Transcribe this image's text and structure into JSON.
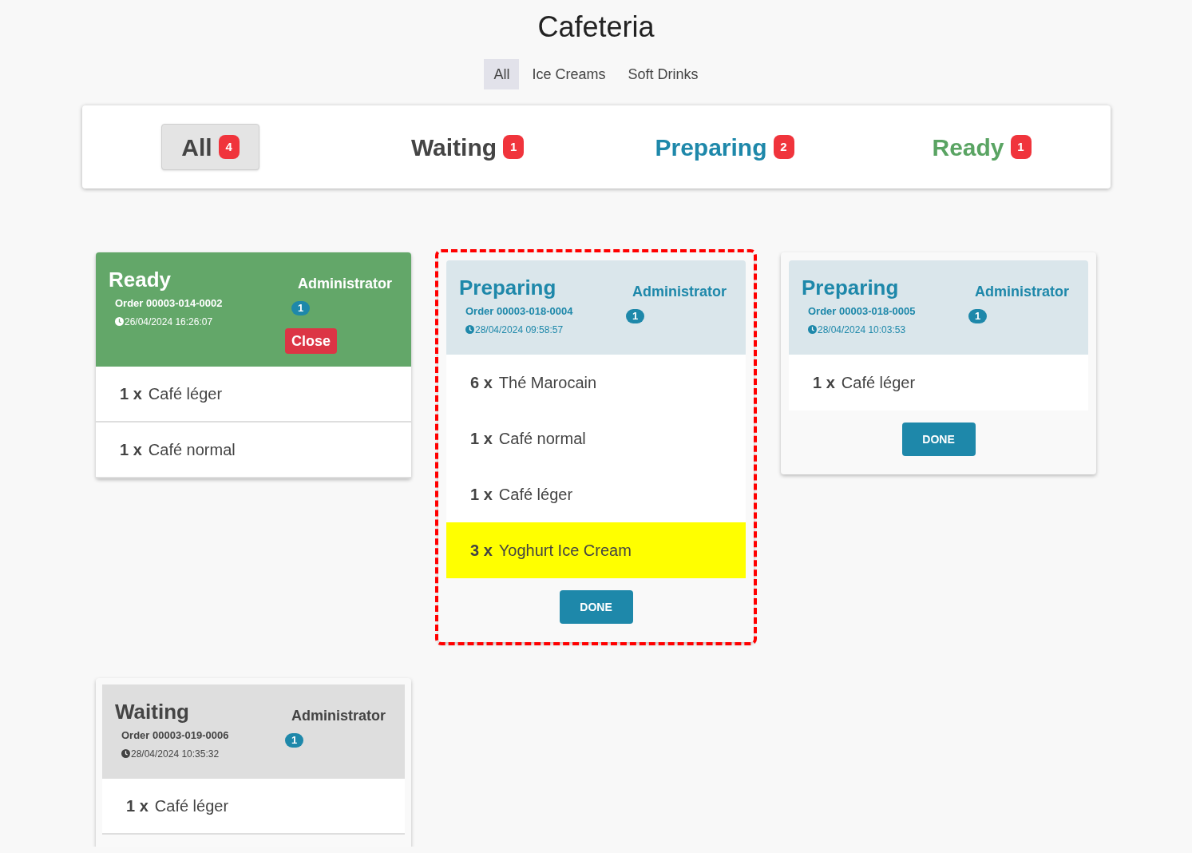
{
  "title": "Cafeteria",
  "categories": [
    {
      "label": "All",
      "selected": true
    },
    {
      "label": "Ice Creams",
      "selected": false
    },
    {
      "label": "Soft Drinks",
      "selected": false
    }
  ],
  "status_filters": [
    {
      "label": "All",
      "count": "4",
      "selected": true,
      "color": "#444444"
    },
    {
      "label": "Waiting",
      "count": "1",
      "selected": false,
      "color": "#444444"
    },
    {
      "label": "Preparing",
      "count": "2",
      "selected": false,
      "color": "#1e88aa"
    },
    {
      "label": "Ready",
      "count": "1",
      "selected": false,
      "color": "#5aa463"
    }
  ],
  "orders": [
    {
      "kind": "ready",
      "status_label": "Ready",
      "user": "Administrator",
      "order": "Order 00003-014-0002",
      "time": "26/04/2024 16:26:07",
      "badge": "1",
      "selected": false,
      "action": "Close",
      "items": [
        {
          "qty": "1 x",
          "name": "Café léger",
          "highlighted": false
        },
        {
          "qty": "1 x",
          "name": "Café normal",
          "highlighted": false
        }
      ]
    },
    {
      "kind": "preparing",
      "status_label": "Preparing",
      "user": "Administrator",
      "order": "Order 00003-018-0004",
      "time": "28/04/2024 09:58:57",
      "badge": "1",
      "selected": true,
      "action": "DONE",
      "items": [
        {
          "qty": "6 x",
          "name": "Thé Marocain",
          "highlighted": false
        },
        {
          "qty": "1 x",
          "name": "Café normal",
          "highlighted": false
        },
        {
          "qty": "1 x",
          "name": "Café léger",
          "highlighted": false
        },
        {
          "qty": "3 x",
          "name": "Yoghurt Ice Cream",
          "highlighted": true
        }
      ]
    },
    {
      "kind": "preparing",
      "status_label": "Preparing",
      "user": "Administrator",
      "order": "Order 00003-018-0005",
      "time": "28/04/2024 10:03:53",
      "badge": "1",
      "selected": false,
      "action": "DONE",
      "items": [
        {
          "qty": "1 x",
          "name": "Café léger",
          "highlighted": false
        }
      ]
    },
    {
      "kind": "waiting",
      "status_label": "Waiting",
      "user": "Administrator",
      "order": "Order 00003-019-0006",
      "time": "28/04/2024 10:35:32",
      "badge": "1",
      "selected": false,
      "items": [
        {
          "qty": "1 x",
          "name": "Café léger",
          "highlighted": false
        }
      ]
    }
  ]
}
